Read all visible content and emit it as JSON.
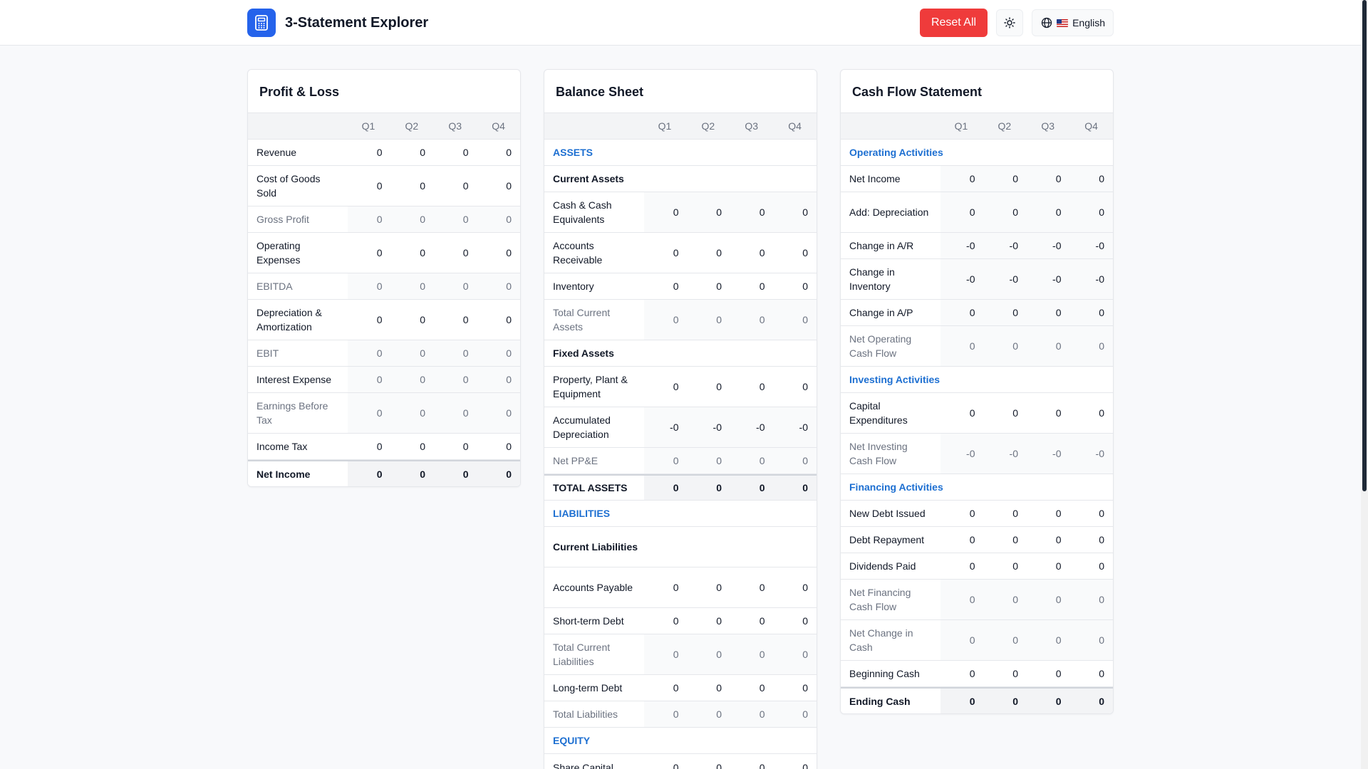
{
  "header": {
    "title": "3-Statement Explorer",
    "reset_label": "Reset All",
    "language_label": "English"
  },
  "colors": {
    "accent": "#2563eb",
    "reset": "#ef3b3b",
    "section": "#1d6fd1"
  },
  "quarters": [
    "Q1",
    "Q2",
    "Q3",
    "Q4"
  ],
  "pl": {
    "title": "Profit & Loss",
    "rows": [
      {
        "label": "Revenue",
        "kind": "input",
        "h": 1,
        "values": [
          "0",
          "0",
          "0",
          "0"
        ]
      },
      {
        "label": "Cost of Goods Sold",
        "kind": "input",
        "h": 2,
        "values": [
          "0",
          "0",
          "0",
          "0"
        ]
      },
      {
        "label": "Gross Profit",
        "kind": "calc",
        "h": 1,
        "values": [
          "0",
          "0",
          "0",
          "0"
        ]
      },
      {
        "label": "Operating Expenses",
        "kind": "input",
        "h": 2,
        "values": [
          "0",
          "0",
          "0",
          "0"
        ]
      },
      {
        "label": "EBITDA",
        "kind": "calc",
        "h": 1,
        "values": [
          "0",
          "0",
          "0",
          "0"
        ]
      },
      {
        "label": "Depreciation & Amortization",
        "kind": "input",
        "h": 2,
        "values": [
          "0",
          "0",
          "0",
          "0"
        ]
      },
      {
        "label": "EBIT",
        "kind": "calc",
        "h": 1,
        "values": [
          "0",
          "0",
          "0",
          "0"
        ]
      },
      {
        "label": "Interest Expense",
        "kind": "input-calc",
        "h": 1,
        "values": [
          "0",
          "0",
          "0",
          "0"
        ]
      },
      {
        "label": "Earnings Before Tax",
        "kind": "calc",
        "h": 2,
        "values": [
          "0",
          "0",
          "0",
          "0"
        ]
      },
      {
        "label": "Income Tax",
        "kind": "input",
        "h": 1,
        "values": [
          "0",
          "0",
          "0",
          "0"
        ]
      },
      {
        "label": "Net Income",
        "kind": "total",
        "h": 1,
        "values": [
          "0",
          "0",
          "0",
          "0"
        ]
      }
    ]
  },
  "bs": {
    "title": "Balance Sheet",
    "rows": [
      {
        "label": "ASSETS",
        "kind": "section",
        "h": 1
      },
      {
        "label": "Current Assets",
        "kind": "sub",
        "h": 1
      },
      {
        "label": "Cash & Cash Equivalents",
        "kind": "calc-dark",
        "h": 2,
        "values": [
          "0",
          "0",
          "0",
          "0"
        ]
      },
      {
        "label": "Accounts Receivable",
        "kind": "input",
        "h": 2,
        "values": [
          "0",
          "0",
          "0",
          "0"
        ]
      },
      {
        "label": "Inventory",
        "kind": "input",
        "h": 1,
        "values": [
          "0",
          "0",
          "0",
          "0"
        ]
      },
      {
        "label": "Total Current Assets",
        "kind": "calc",
        "h": 2,
        "values": [
          "0",
          "0",
          "0",
          "0"
        ]
      },
      {
        "label": "Fixed Assets",
        "kind": "sub",
        "h": 1
      },
      {
        "label": "Property, Plant & Equipment",
        "kind": "input",
        "h": 2,
        "values": [
          "0",
          "0",
          "0",
          "0"
        ]
      },
      {
        "label": "Accumulated Depreciation",
        "kind": "calc-dark",
        "h": 2,
        "values": [
          "-0",
          "-0",
          "-0",
          "-0"
        ]
      },
      {
        "label": "Net PP&E",
        "kind": "calc",
        "h": 1,
        "values": [
          "0",
          "0",
          "0",
          "0"
        ]
      },
      {
        "label": "TOTAL ASSETS",
        "kind": "total",
        "h": 1,
        "values": [
          "0",
          "0",
          "0",
          "0"
        ]
      },
      {
        "label": "LIABILITIES",
        "kind": "section",
        "h": 1
      },
      {
        "label": "Current Liabilities",
        "kind": "sub",
        "h": 2
      },
      {
        "label": "Accounts Payable",
        "kind": "input",
        "h": 2,
        "values": [
          "0",
          "0",
          "0",
          "0"
        ]
      },
      {
        "label": "Short-term Debt",
        "kind": "input",
        "h": 1,
        "values": [
          "0",
          "0",
          "0",
          "0"
        ]
      },
      {
        "label": "Total Current Liabilities",
        "kind": "calc",
        "h": 2,
        "values": [
          "0",
          "0",
          "0",
          "0"
        ]
      },
      {
        "label": "Long-term Debt",
        "kind": "input",
        "h": 1,
        "values": [
          "0",
          "0",
          "0",
          "0"
        ]
      },
      {
        "label": "Total Liabilities",
        "kind": "calc",
        "h": 1,
        "values": [
          "0",
          "0",
          "0",
          "0"
        ]
      },
      {
        "label": "EQUITY",
        "kind": "section",
        "h": 1
      },
      {
        "label": "Share Capital",
        "kind": "input",
        "h": 1,
        "values": [
          "0",
          "0",
          "0",
          "0"
        ]
      }
    ]
  },
  "cf": {
    "title": "Cash Flow Statement",
    "rows": [
      {
        "label": "Operating Activities",
        "kind": "section",
        "h": 1
      },
      {
        "label": "Net Income",
        "kind": "calc-dark",
        "h": 1,
        "values": [
          "0",
          "0",
          "0",
          "0"
        ]
      },
      {
        "label": "Add: Depreciation",
        "kind": "calc-dark",
        "h": 2,
        "values": [
          "0",
          "0",
          "0",
          "0"
        ]
      },
      {
        "label": "Change in A/R",
        "kind": "calc-dark",
        "h": 1,
        "values": [
          "-0",
          "-0",
          "-0",
          "-0"
        ]
      },
      {
        "label": "Change in Inventory",
        "kind": "calc-dark",
        "h": 2,
        "values": [
          "-0",
          "-0",
          "-0",
          "-0"
        ]
      },
      {
        "label": "Change in A/P",
        "kind": "calc-dark",
        "h": 1,
        "values": [
          "0",
          "0",
          "0",
          "0"
        ]
      },
      {
        "label": "Net Operating Cash Flow",
        "kind": "calc",
        "h": 2,
        "values": [
          "0",
          "0",
          "0",
          "0"
        ]
      },
      {
        "label": "Investing Activities",
        "kind": "section",
        "h": 1
      },
      {
        "label": "Capital Expenditures",
        "kind": "input",
        "h": 2,
        "values": [
          "0",
          "0",
          "0",
          "0"
        ]
      },
      {
        "label": "Net Investing Cash Flow",
        "kind": "calc",
        "h": 2,
        "values": [
          "-0",
          "-0",
          "-0",
          "-0"
        ]
      },
      {
        "label": "Financing Activities",
        "kind": "section",
        "h": 1
      },
      {
        "label": "New Debt Issued",
        "kind": "input",
        "h": 1,
        "values": [
          "0",
          "0",
          "0",
          "0"
        ]
      },
      {
        "label": "Debt Repayment",
        "kind": "input",
        "h": 1,
        "values": [
          "0",
          "0",
          "0",
          "0"
        ]
      },
      {
        "label": "Dividends Paid",
        "kind": "input",
        "h": 1,
        "values": [
          "0",
          "0",
          "0",
          "0"
        ]
      },
      {
        "label": "Net Financing Cash Flow",
        "kind": "calc",
        "h": 2,
        "values": [
          "0",
          "0",
          "0",
          "0"
        ]
      },
      {
        "label": "Net Change in Cash",
        "kind": "calc",
        "h": 2,
        "values": [
          "0",
          "0",
          "0",
          "0"
        ]
      },
      {
        "label": "Beginning Cash",
        "kind": "input",
        "h": 1,
        "values": [
          "0",
          "0",
          "0",
          "0"
        ]
      },
      {
        "label": "Ending Cash",
        "kind": "total",
        "h": 1,
        "values": [
          "0",
          "0",
          "0",
          "0"
        ]
      }
    ]
  }
}
